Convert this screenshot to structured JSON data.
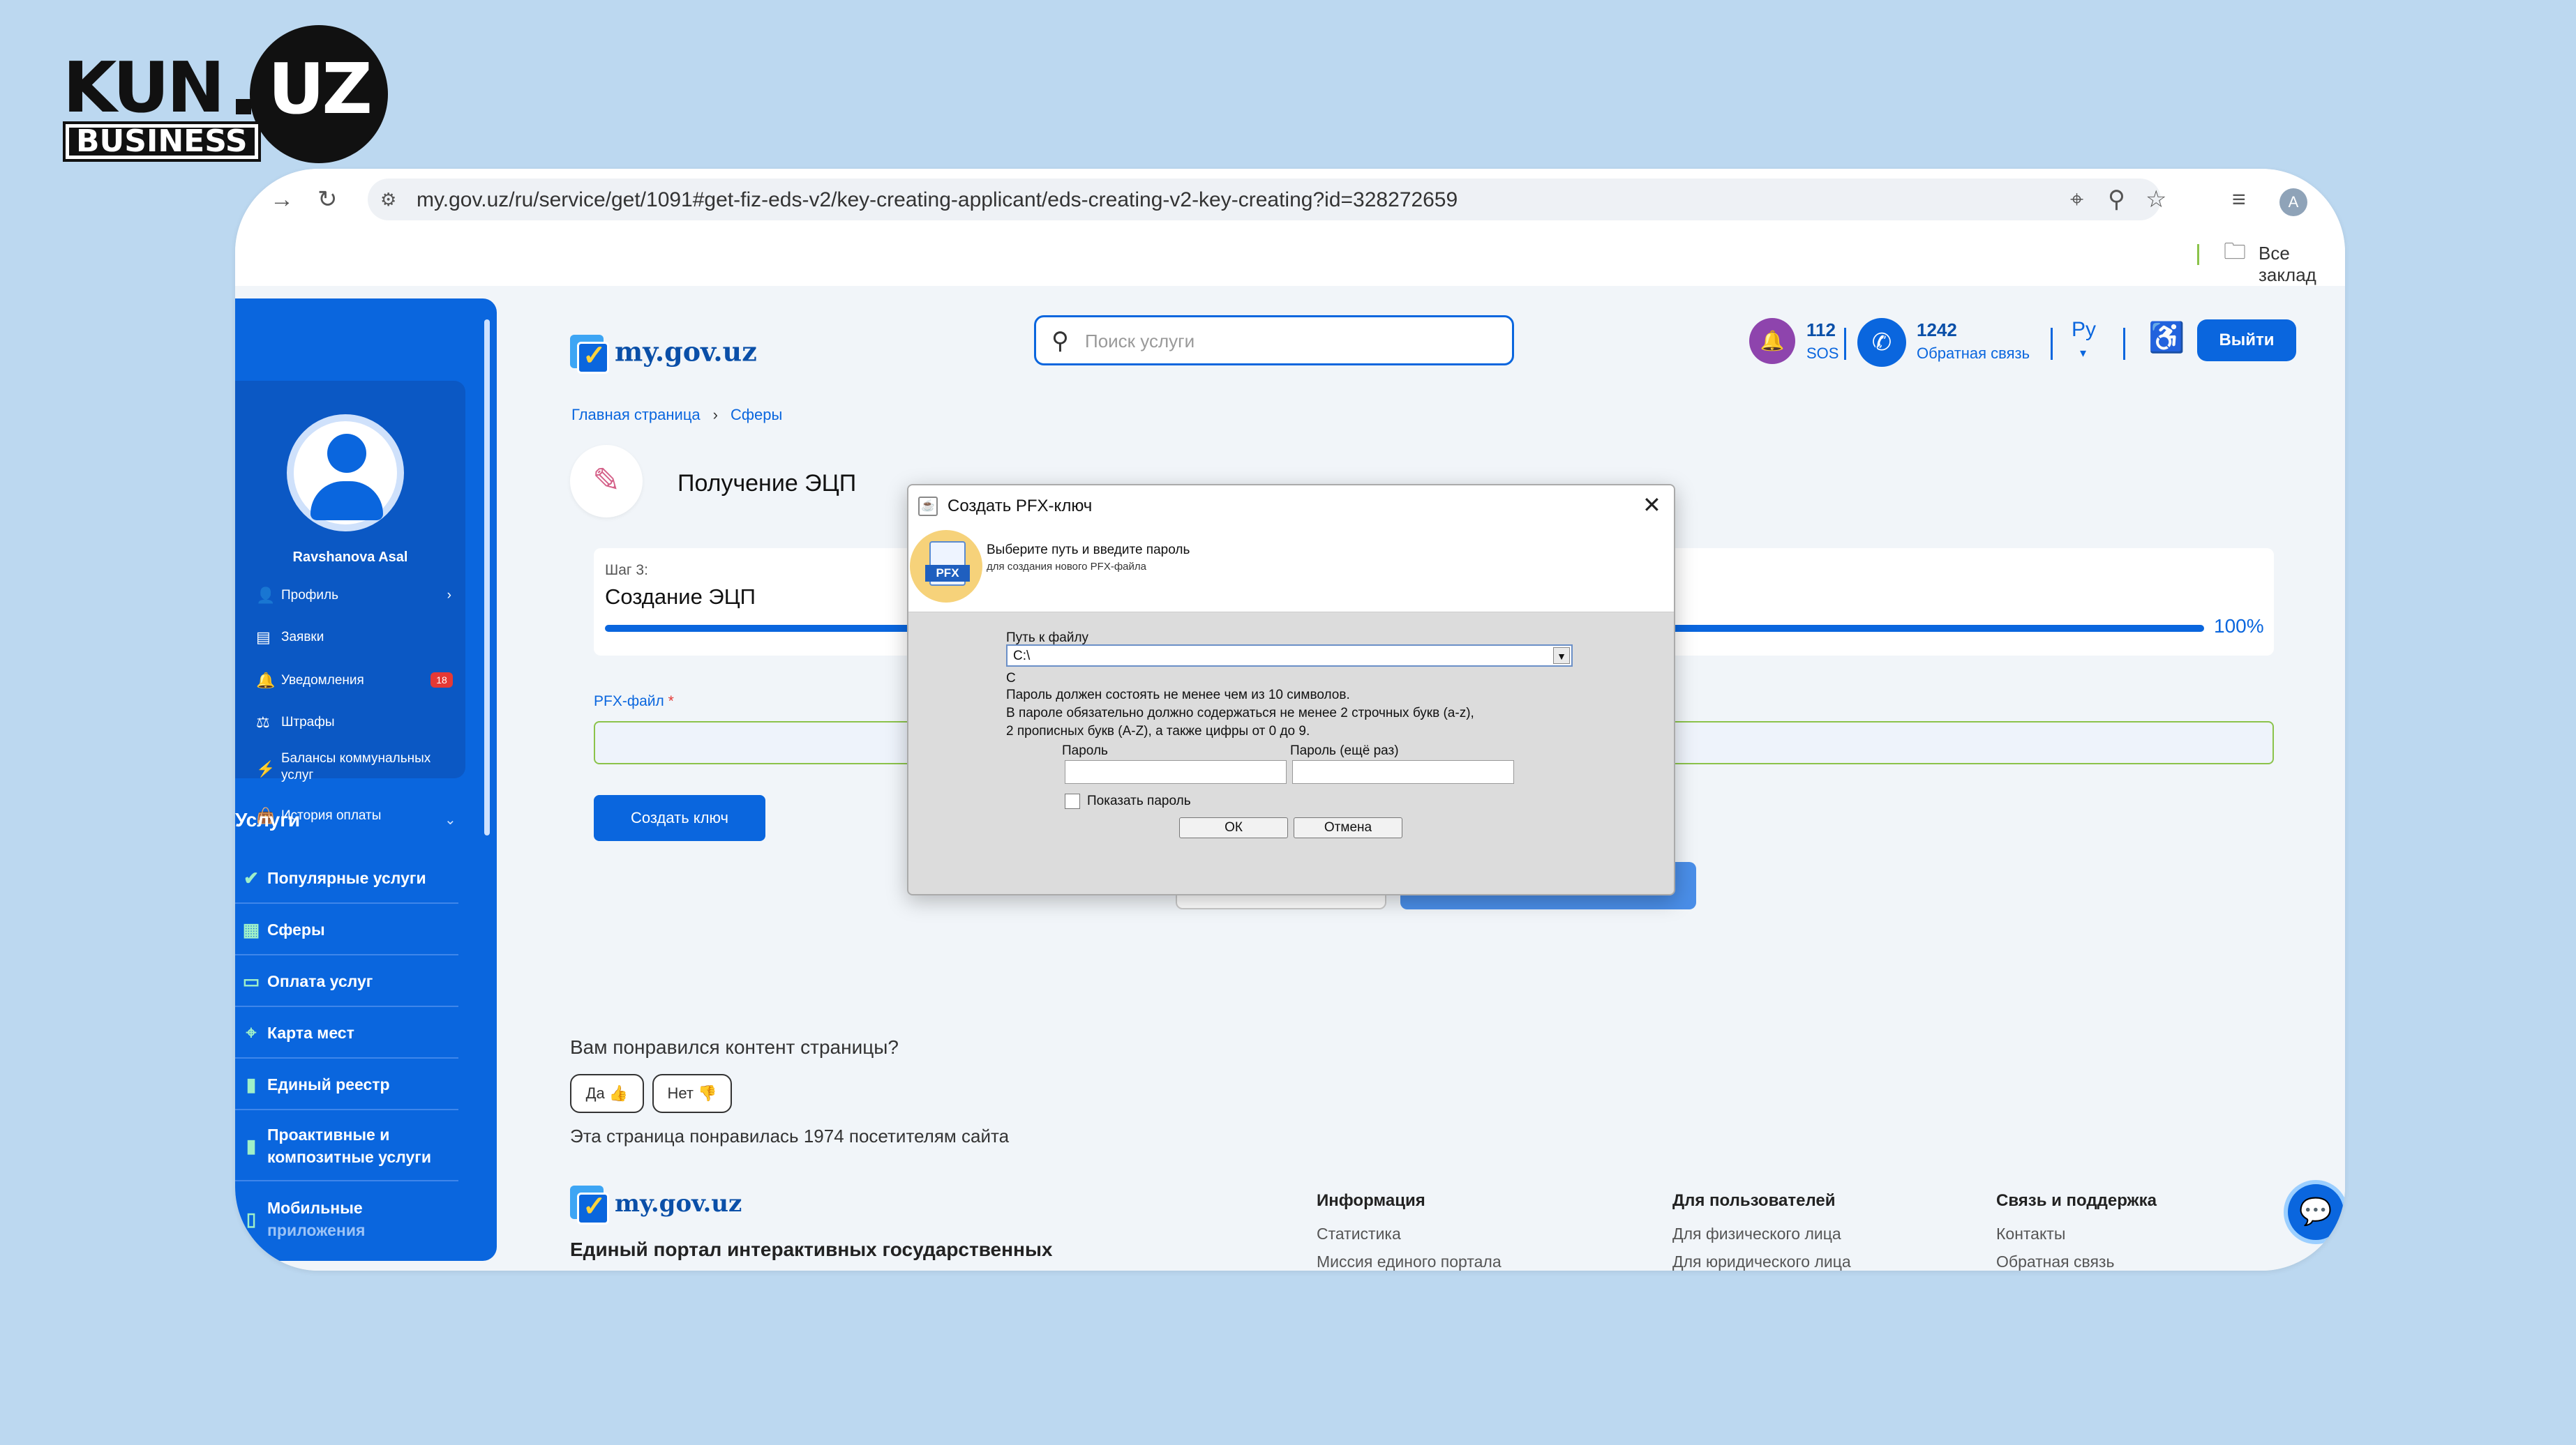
{
  "brand": {
    "kun": "KUN",
    "uz": "UZ",
    "business": "BUSINESS"
  },
  "browser": {
    "url": "my.gov.uz/ru/service/get/1091#get-fiz-eds-v2/key-creating-applicant/eds-creating-v2-key-creating?id=328272659",
    "bookmarks_label": "Все заклад",
    "profile_initial": "A"
  },
  "sidebar": {
    "user_name": "Ravshanova Asal",
    "profile_menu": [
      {
        "label": "Профиль",
        "icon": "person-icon"
      },
      {
        "label": "Заявки",
        "icon": "document-icon"
      },
      {
        "label": "Уведомления",
        "icon": "bell-icon",
        "badge": "18"
      },
      {
        "label": "Штрафы",
        "icon": "fine-icon"
      },
      {
        "label": "Балансы коммунальных",
        "label2": "услуг",
        "icon": "utility-icon"
      },
      {
        "label": "История оплаты",
        "icon": "wallet-icon"
      }
    ],
    "services_title": "Услуги",
    "services": [
      {
        "label": "Популярные услуги",
        "icon": "check-badge-icon"
      },
      {
        "label": "Сферы",
        "icon": "grid-icon"
      },
      {
        "label": "Оплата услуг",
        "icon": "card-icon"
      },
      {
        "label": "Карта мест",
        "icon": "map-pin-icon"
      },
      {
        "label": "Единый реестр",
        "icon": "file-icon"
      },
      {
        "label": "Проактивные и",
        "label2": "композитные услуги",
        "icon": "file-check-icon"
      },
      {
        "label": "Мобильные",
        "label2": "приложения",
        "icon": "phone-icon"
      }
    ]
  },
  "header": {
    "site_name": "my.gov.uz",
    "search_placeholder": "Поиск услуги",
    "sos_number": "112",
    "sos_label": "SOS",
    "phone_number": "1242",
    "phone_label": "Обратная связь",
    "language": "Ру",
    "logout": "Выйти"
  },
  "breadcrumb": [
    "Главная страница",
    "Сферы"
  ],
  "page": {
    "title": "Получение ЭЦП",
    "step_label": "Шаг 3:",
    "step_title": "Создание ЭЦП",
    "progress_percent": 100,
    "progress_text": "100%",
    "pfx_label": "PFX-файл",
    "required_mark": "*",
    "create_key_button": "Создать ключ"
  },
  "feedback": {
    "question": "Вам понравился контент страницы?",
    "yes": "Да",
    "no": "Нет",
    "count_text": "Эта страница понравилась 1974 посетителям сайта"
  },
  "footer": {
    "site_name": "my.gov.uz",
    "tagline": "Единый портал интерактивных государственных",
    "columns": [
      {
        "title": "Информация",
        "links": [
          "Статистика",
          "Миссия единого портала"
        ]
      },
      {
        "title": "Для пользователей",
        "links": [
          "Для физического лица",
          "Для юридического лица"
        ]
      },
      {
        "title": "Связь и поддержка",
        "links": [
          "Контакты",
          "Обратная связь"
        ]
      }
    ]
  },
  "dialog": {
    "title": "Создать PFX-ключ",
    "header_line1": "Выберите путь и введите пароль",
    "header_line2": "для создания нового PFX-файла",
    "icon_text": "PFX",
    "path_label": "Путь к файлу",
    "path_value": "C:\\",
    "path_echo": "C",
    "rules": [
      "Пароль должен состоять не менее чем из 10 символов.",
      "В пароле обязательно должно содержаться не менее 2 строчных букв (a-z),",
      "2 прописных букв (A-Z), а также цифры от 0 до 9."
    ],
    "password_label": "Пароль",
    "password_repeat_label": "Пароль (ещё раз)",
    "show_password_label": "Показать пароль",
    "ok": "ОК",
    "cancel": "Отмена"
  }
}
